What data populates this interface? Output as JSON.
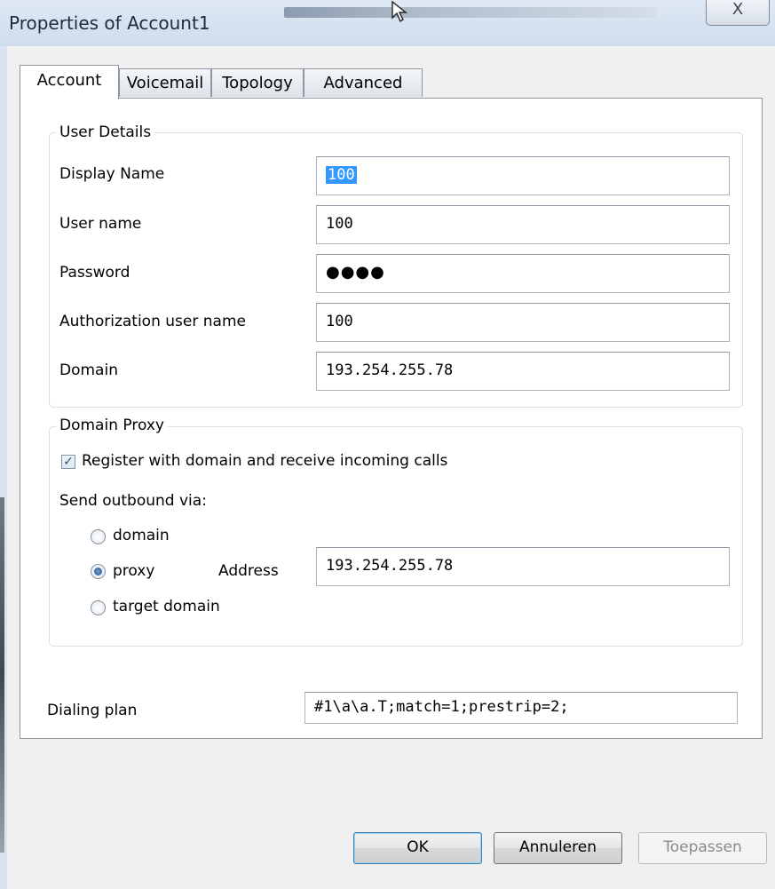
{
  "window": {
    "title": "Properties of Account1",
    "close_label": "X"
  },
  "tabs": [
    {
      "label": "Account"
    },
    {
      "label": "Voicemail"
    },
    {
      "label": "Topology"
    },
    {
      "label": "Advanced"
    }
  ],
  "user_details": {
    "group_label": "User Details",
    "display_name_label": "Display Name",
    "display_name_value": "100",
    "user_name_label": "User name",
    "user_name_value": "100",
    "password_label": "Password",
    "password_mask": "●●●●",
    "auth_user_label": "Authorization user name",
    "auth_user_value": "100",
    "domain_label": "Domain",
    "domain_value": "193.254.255.78"
  },
  "domain_proxy": {
    "group_label": "Domain Proxy",
    "register_label": "Register with domain and receive incoming calls",
    "register_checked": true,
    "send_outbound_label": "Send outbound via:",
    "options": [
      {
        "label": "domain",
        "selected": false
      },
      {
        "label": "proxy",
        "selected": true
      },
      {
        "label": "target domain",
        "selected": false
      }
    ],
    "address_label": "Address",
    "address_value": "193.254.255.78"
  },
  "dialing_plan": {
    "label": "Dialing plan",
    "value": "#1\\a\\a.T;match=1;prestrip=2;"
  },
  "buttons": {
    "ok": "OK",
    "cancel": "Annuleren",
    "apply": "Toepassen"
  }
}
